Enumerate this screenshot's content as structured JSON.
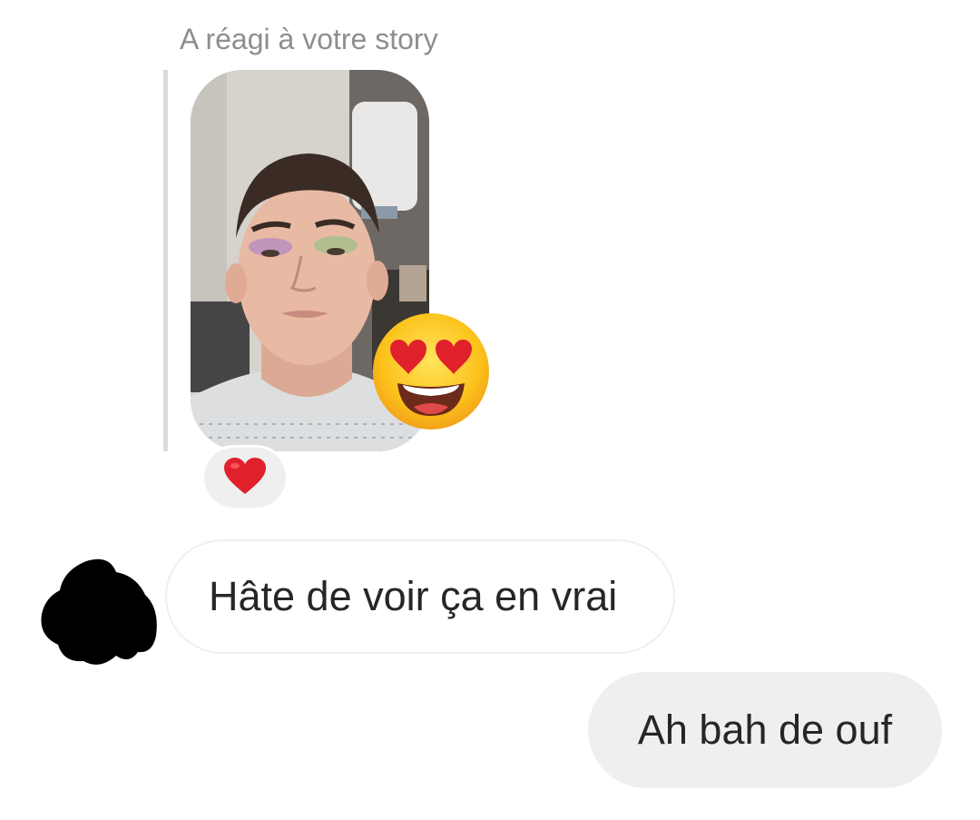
{
  "story": {
    "caption": "A réagi à votre story",
    "thumbnail_icon": "story-photo",
    "reaction_emoji_icon": "heart-eyes-emoji-icon"
  },
  "reaction_badge": {
    "icon": "red-heart-icon",
    "color": "#e0212b"
  },
  "messages": [
    {
      "sender": "other",
      "text": "Hâte de voir ça en vrai"
    },
    {
      "sender": "me",
      "text": "Ah bah de ouf"
    }
  ],
  "colors": {
    "caption": "#8e8e8e",
    "bubble_out_bg": "#efefef",
    "bubble_in_border": "#efefef",
    "text": "#262626",
    "avatar_redaction": "#000000"
  }
}
